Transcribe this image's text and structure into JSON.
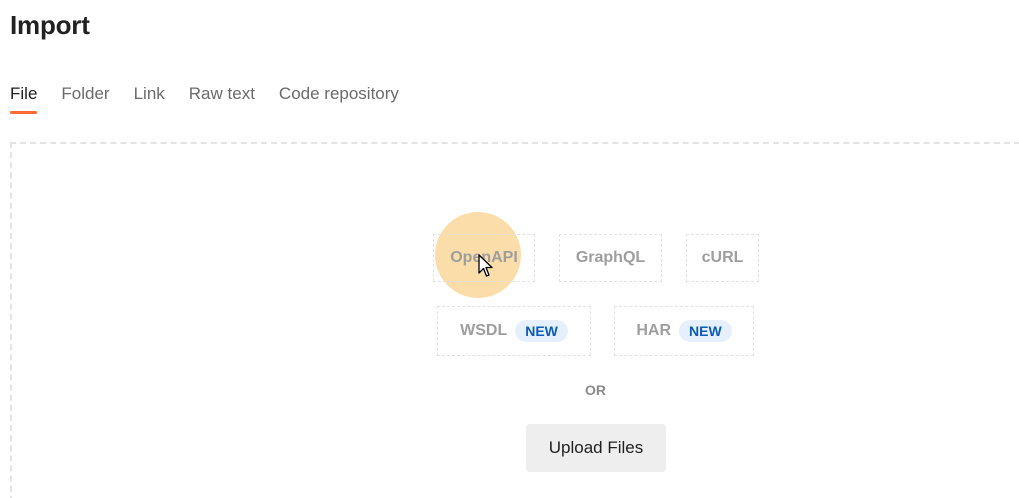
{
  "title": "Import",
  "tabs": [
    {
      "label": "File",
      "active": true
    },
    {
      "label": "Folder",
      "active": false
    },
    {
      "label": "Link",
      "active": false
    },
    {
      "label": "Raw text",
      "active": false
    },
    {
      "label": "Code repository",
      "active": false
    }
  ],
  "formats": {
    "openapi": "OpenAPI",
    "graphql": "GraphQL",
    "curl": "cURL",
    "wsdl": "WSDL",
    "har": "HAR",
    "new_badge": "NEW"
  },
  "or_label": "OR",
  "upload_label": "Upload Files",
  "colors": {
    "accent": "#ff6c37",
    "badge_bg": "#e6f0fd",
    "badge_text": "#0b5cb5",
    "click_highlight": "#fad28c"
  },
  "icons": {
    "cursor": "mouse-pointer-icon"
  }
}
